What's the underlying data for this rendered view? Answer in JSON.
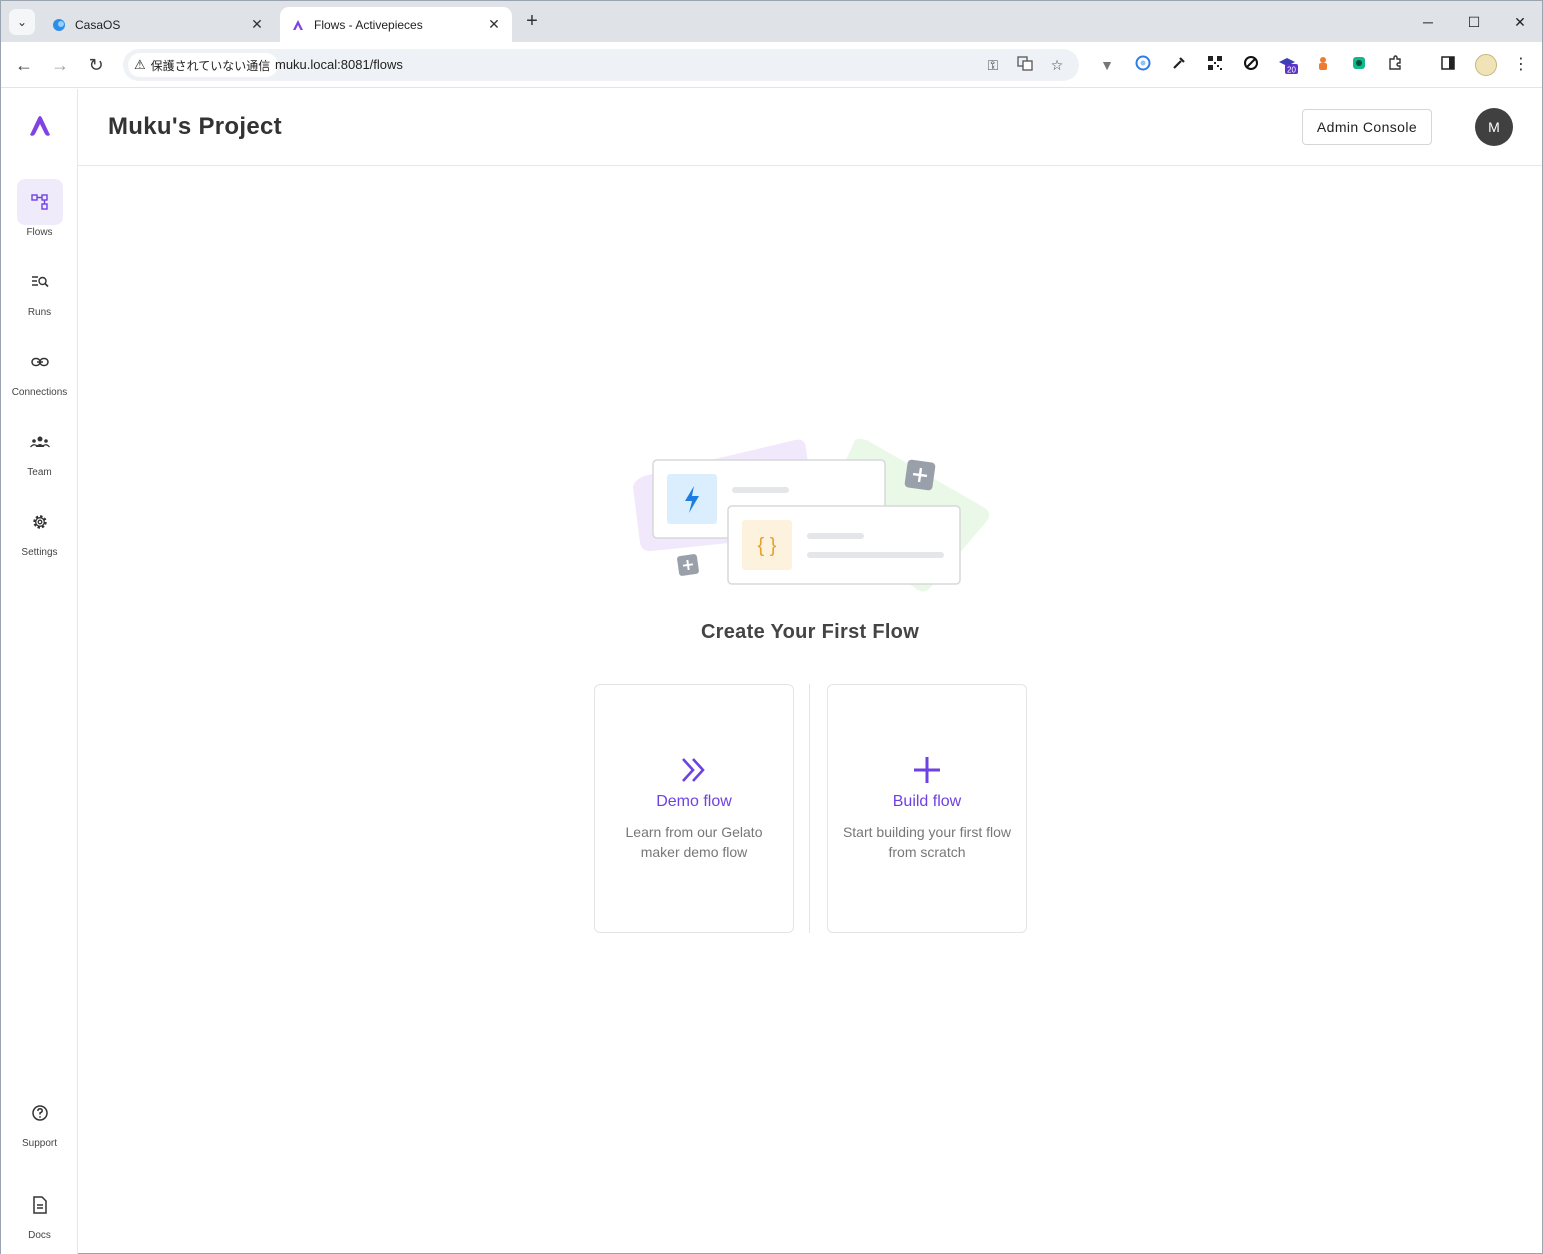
{
  "browser": {
    "tabs": [
      {
        "title": "CasaOS",
        "active": false
      },
      {
        "title": "Flows - Activepieces",
        "active": true
      }
    ],
    "security_label": "保護されていない通信",
    "url": "muku.local:8081/flows",
    "extension_badge": "20"
  },
  "sidebar": {
    "items": [
      {
        "label": "Flows",
        "icon": "flows-icon",
        "active": true
      },
      {
        "label": "Runs",
        "icon": "runs-icon",
        "active": false
      },
      {
        "label": "Connections",
        "icon": "link-icon",
        "active": false
      },
      {
        "label": "Team",
        "icon": "team-icon",
        "active": false
      },
      {
        "label": "Settings",
        "icon": "gear-icon",
        "active": false
      }
    ],
    "bottom_items": [
      {
        "label": "Support",
        "icon": "question-icon"
      },
      {
        "label": "Docs",
        "icon": "document-icon"
      }
    ]
  },
  "header": {
    "project_title": "Muku's Project",
    "admin_button": "Admin Console",
    "avatar_initial": "M"
  },
  "main": {
    "empty_title": "Create Your First Flow",
    "cards": [
      {
        "title": "Demo flow",
        "description": "Learn from our Gelato maker demo flow",
        "icon": "double-chevron-right-icon"
      },
      {
        "title": "Build flow",
        "description": "Start building your first flow from scratch",
        "icon": "plus-icon"
      }
    ],
    "illustration_code_glyph": "{ }"
  },
  "colors": {
    "accent": "#6e41e2",
    "nav_active_bg": "#f0ebfb",
    "avatar_bg": "#404040"
  }
}
